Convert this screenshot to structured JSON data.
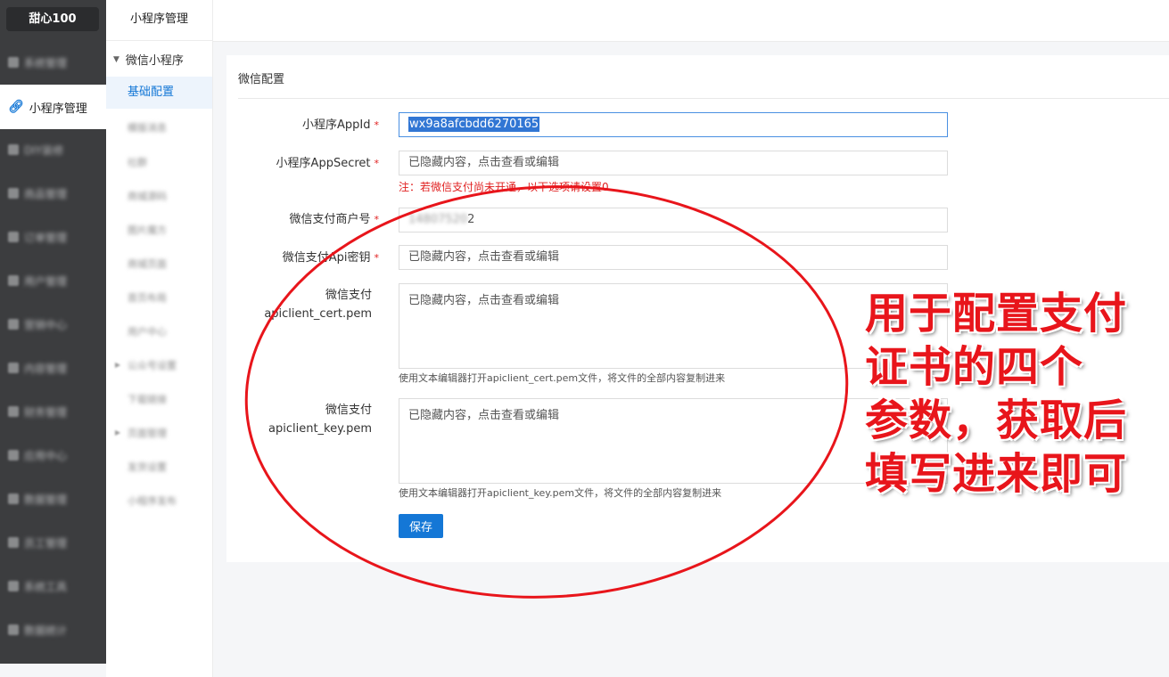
{
  "brand": "甜心100",
  "sidebar": {
    "items": [
      {
        "label": "系统管理",
        "icon": "home-icon"
      },
      {
        "label": "DIY装修",
        "icon": "brush-icon"
      },
      {
        "label": "商品管理",
        "icon": "goods-icon"
      },
      {
        "label": "订单管理",
        "icon": "order-icon"
      },
      {
        "label": "用户管理",
        "icon": "user-icon"
      },
      {
        "label": "营销中心",
        "icon": "marketing-icon"
      },
      {
        "label": "内容管理",
        "icon": "content-icon"
      },
      {
        "label": "财务管理",
        "icon": "finance-icon"
      },
      {
        "label": "应用中心",
        "icon": "app-icon"
      },
      {
        "label": "数据管理",
        "icon": "data-icon"
      },
      {
        "label": "员工管理",
        "icon": "staff-icon"
      },
      {
        "label": "系统工具",
        "icon": "tool-icon"
      },
      {
        "label": "数据统计",
        "icon": "stats-icon"
      }
    ],
    "active": {
      "label": "小程序管理",
      "icon": "link-icon"
    }
  },
  "subnav": {
    "title": "小程序管理",
    "group": "微信小程序",
    "active": "基础配置",
    "items": [
      "模版消息",
      "社群",
      "商城源码",
      "图片魔方",
      "商城页面",
      "首页布局",
      "用户中心",
      "公众号设置",
      "下载链接",
      "页面管理",
      "发货设置",
      "小程序发布"
    ]
  },
  "card": {
    "title": "微信配置",
    "fields": {
      "appid_label": "小程序AppId",
      "appid_value": "wx9a8afcbdd6270165",
      "secret_label": "小程序AppSecret",
      "secret_placeholder": "已隐藏内容，点击查看或编辑",
      "warn_note": "注：若微信支付尚未开通，以下选项请设置0",
      "mch_label": "微信支付商户号",
      "mch_value_hidden": "14807520",
      "mch_value_tail": "2",
      "apikey_label": "微信支付Api密钥",
      "apikey_placeholder": "已隐藏内容，点击查看或编辑",
      "cert_label_1": "微信支付",
      "cert_label_2": "apiclient_cert.pem",
      "cert_placeholder": "已隐藏内容，点击查看或编辑",
      "cert_note": "使用文本编辑器打开apiclient_cert.pem文件，将文件的全部内容复制进来",
      "key_label_1": "微信支付",
      "key_label_2": "apiclient_key.pem",
      "key_placeholder": "已隐藏内容，点击查看或编辑",
      "key_note": "使用文本编辑器打开apiclient_key.pem文件，将文件的全部内容复制进来",
      "required_mark": "*"
    },
    "save_label": "保存"
  },
  "annotation": {
    "lines": [
      "用于配置支付",
      "证书的四个",
      "参数，获取后",
      "填写进来即可"
    ],
    "color": "#e8151b"
  }
}
